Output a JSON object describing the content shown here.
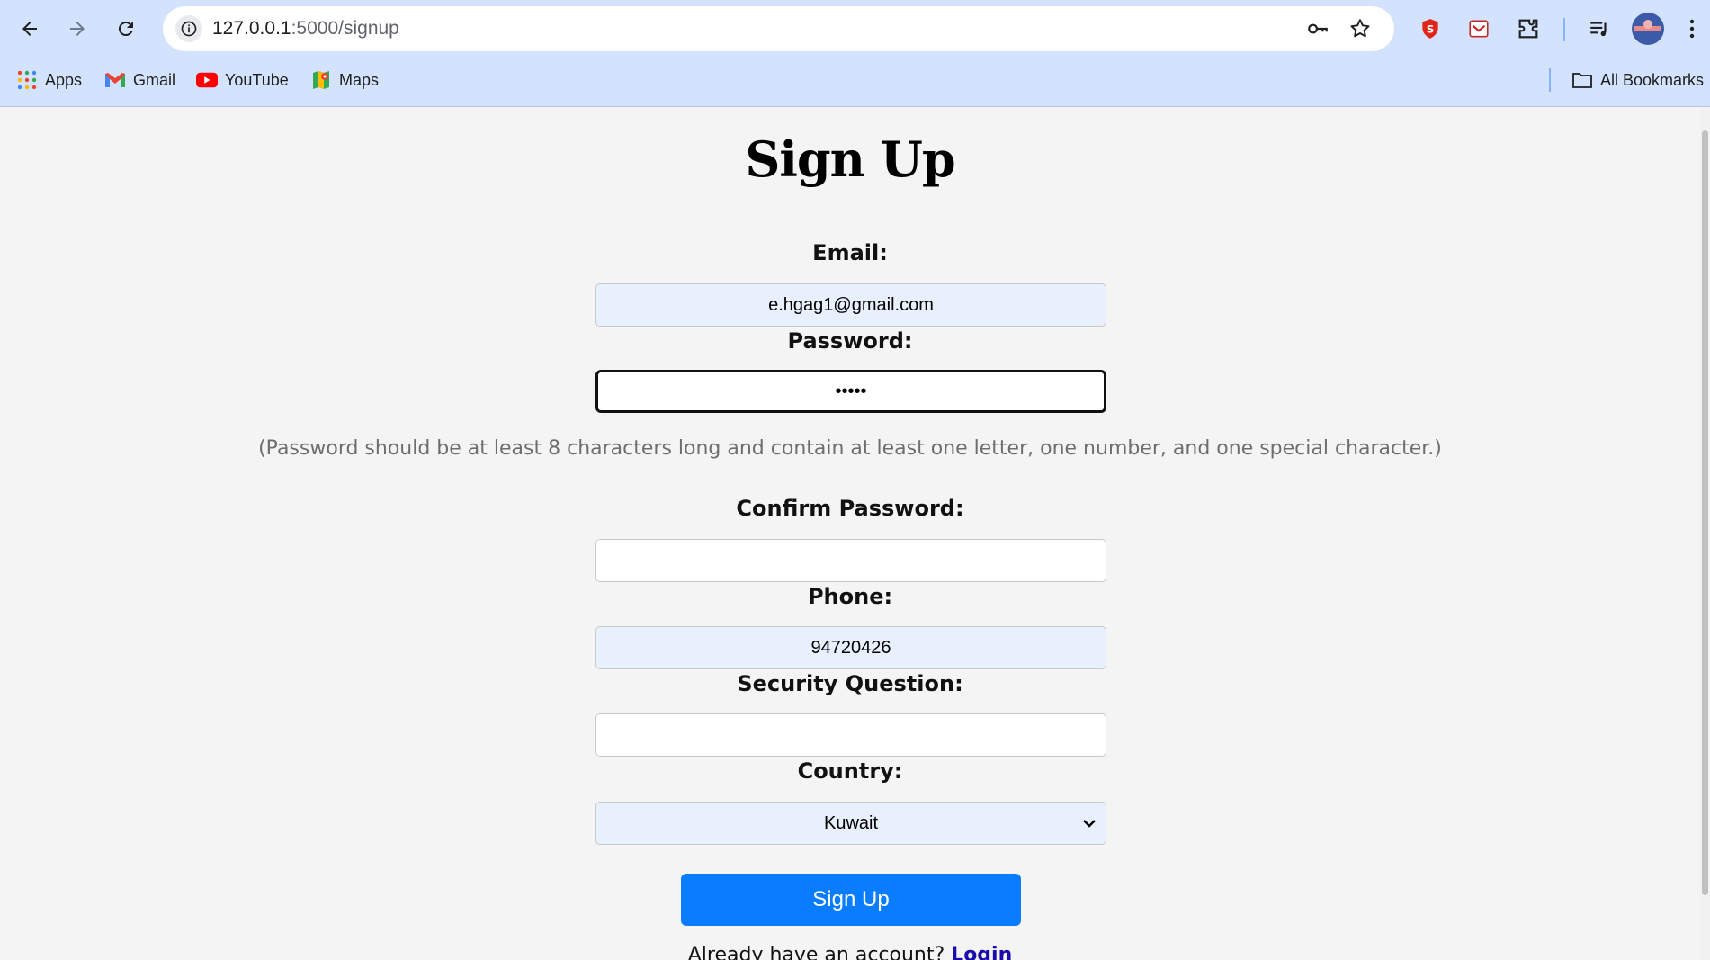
{
  "browser": {
    "url_host": "127.0.0.1",
    "url_path": ":5000/signup",
    "bookmarks": [
      {
        "label": "Apps",
        "icon": "apps-grid-icon"
      },
      {
        "label": "Gmail",
        "icon": "gmail-icon"
      },
      {
        "label": "YouTube",
        "icon": "youtube-icon"
      },
      {
        "label": "Maps",
        "icon": "maps-icon"
      }
    ],
    "all_bookmarks_label": "All Bookmarks",
    "accent_color": "#d3e3fd"
  },
  "form": {
    "title": "Sign Up",
    "email": {
      "label": "Email:",
      "value": "e.hgag1@gmail.com"
    },
    "password": {
      "label": "Password:",
      "value": "•••••"
    },
    "password_hint": "(Password should be at least 8 characters long and contain at least one letter, one number, and one special character.)",
    "confirm_password": {
      "label": "Confirm Password:",
      "value": ""
    },
    "phone": {
      "label": "Phone:",
      "value": "94720426"
    },
    "security_question": {
      "label": "Security Question:",
      "value": ""
    },
    "country": {
      "label": "Country:",
      "selected": "Kuwait"
    },
    "submit_label": "Sign Up",
    "submit_color": "#0a7cff",
    "login_prompt": "Already have an account?",
    "login_link": "Login"
  }
}
